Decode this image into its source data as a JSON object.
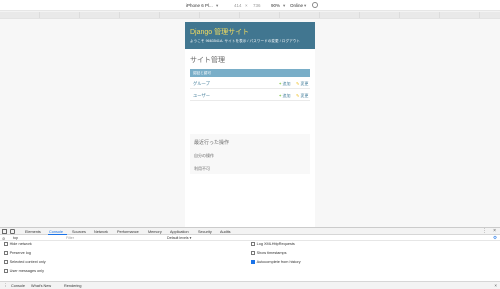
{
  "device_toolbar": {
    "device": "iPhone 6 Pl...",
    "width": "414",
    "times": "×",
    "height": "736",
    "zoom": "90%",
    "network": "Online"
  },
  "django": {
    "site_title": "Django 管理サイト",
    "user_tools": "ようこそ 9663541A. サイトを表示 / パスワードの変更 / ログアウト",
    "page_title": "サイト管理",
    "module": {
      "caption": "認証と認可",
      "rows": [
        {
          "name": "グループ",
          "add": "追加",
          "change": "変更"
        },
        {
          "name": "ユーザー",
          "add": "追加",
          "change": "変更"
        }
      ]
    },
    "recent": {
      "title": "最近行った操作",
      "subtitle": "自分の操作",
      "none": "利用不可"
    }
  },
  "devtools": {
    "tabs": [
      "Elements",
      "Console",
      "Sources",
      "Network",
      "Performance",
      "Memory",
      "Application",
      "Security",
      "Audits"
    ],
    "active_tab": "Console",
    "context": "top",
    "filter_placeholder": "Filter",
    "levels": "Default levels ▾",
    "options_left": [
      {
        "label": "Hide network",
        "checked": false
      },
      {
        "label": "Preserve log",
        "checked": false
      },
      {
        "label": "Selected context only",
        "checked": false
      },
      {
        "label": "User messages only",
        "checked": false
      }
    ],
    "options_right": [
      {
        "label": "Log XMLHttpRequests",
        "checked": false
      },
      {
        "label": "Show timestamps",
        "checked": false
      },
      {
        "label": "Autocomplete from history",
        "checked": true
      }
    ],
    "drawer_tabs": [
      "Console",
      "What's New",
      "Rendering"
    ]
  },
  "colors": {
    "header": "#417690",
    "title": "#f5dd5d",
    "caption": "#79aec8",
    "link": "#447e9b",
    "accent": "#1a73e8"
  }
}
